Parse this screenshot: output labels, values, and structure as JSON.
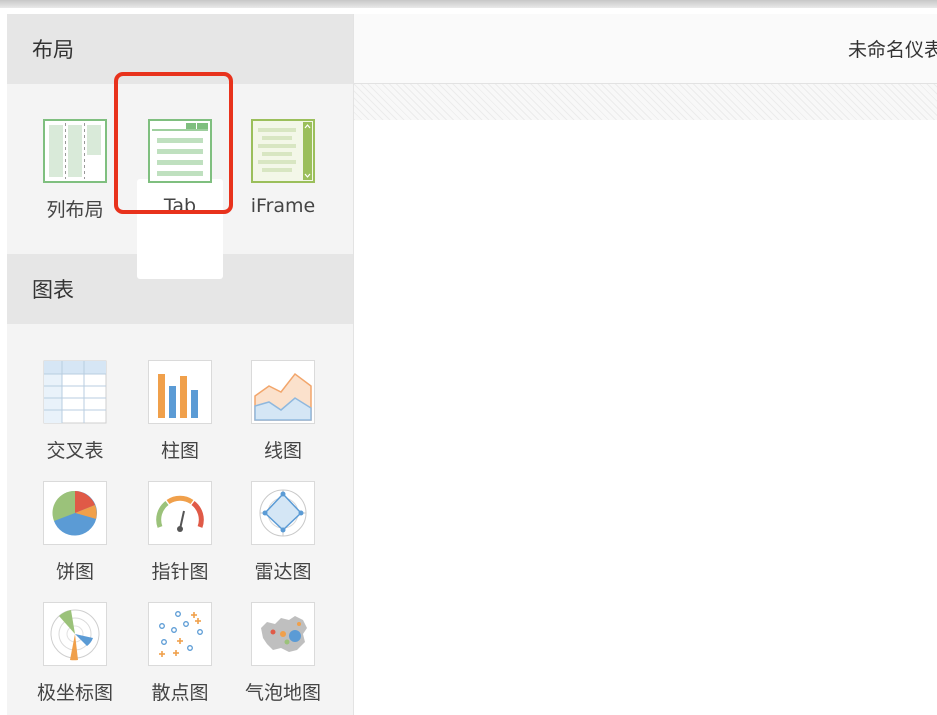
{
  "sidebar": {
    "layout_section": {
      "title": "布局",
      "items": [
        {
          "label": "列布局",
          "icon": "column-layout-icon"
        },
        {
          "label": "Tab",
          "icon": "tab-layout-icon"
        },
        {
          "label": "iFrame",
          "icon": "iframe-icon"
        }
      ]
    },
    "chart_section": {
      "title": "图表",
      "items": [
        {
          "label": "交叉表",
          "icon": "crosstab-icon"
        },
        {
          "label": "柱图",
          "icon": "bar-chart-icon"
        },
        {
          "label": "线图",
          "icon": "line-chart-icon"
        },
        {
          "label": "饼图",
          "icon": "pie-chart-icon"
        },
        {
          "label": "指针图",
          "icon": "gauge-chart-icon"
        },
        {
          "label": "雷达图",
          "icon": "radar-chart-icon"
        },
        {
          "label": "极坐标图",
          "icon": "polar-chart-icon"
        },
        {
          "label": "散点图",
          "icon": "scatter-chart-icon"
        },
        {
          "label": "气泡地图",
          "icon": "bubble-map-icon"
        }
      ]
    }
  },
  "main": {
    "title": "未命名仪表"
  },
  "highlight_color": "#e8321c"
}
